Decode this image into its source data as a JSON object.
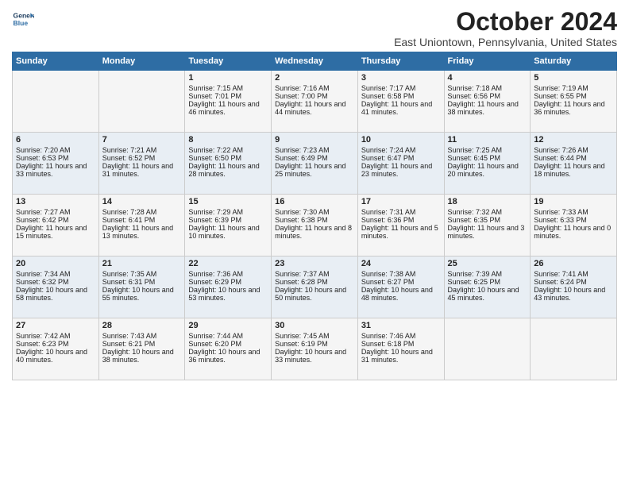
{
  "header": {
    "logo_line1": "General",
    "logo_line2": "Blue",
    "month": "October 2024",
    "location": "East Uniontown, Pennsylvania, United States"
  },
  "weekdays": [
    "Sunday",
    "Monday",
    "Tuesday",
    "Wednesday",
    "Thursday",
    "Friday",
    "Saturday"
  ],
  "weeks": [
    [
      {
        "day": "",
        "content": ""
      },
      {
        "day": "",
        "content": ""
      },
      {
        "day": "1",
        "content": "Sunrise: 7:15 AM\nSunset: 7:01 PM\nDaylight: 11 hours and 46 minutes."
      },
      {
        "day": "2",
        "content": "Sunrise: 7:16 AM\nSunset: 7:00 PM\nDaylight: 11 hours and 44 minutes."
      },
      {
        "day": "3",
        "content": "Sunrise: 7:17 AM\nSunset: 6:58 PM\nDaylight: 11 hours and 41 minutes."
      },
      {
        "day": "4",
        "content": "Sunrise: 7:18 AM\nSunset: 6:56 PM\nDaylight: 11 hours and 38 minutes."
      },
      {
        "day": "5",
        "content": "Sunrise: 7:19 AM\nSunset: 6:55 PM\nDaylight: 11 hours and 36 minutes."
      }
    ],
    [
      {
        "day": "6",
        "content": "Sunrise: 7:20 AM\nSunset: 6:53 PM\nDaylight: 11 hours and 33 minutes."
      },
      {
        "day": "7",
        "content": "Sunrise: 7:21 AM\nSunset: 6:52 PM\nDaylight: 11 hours and 31 minutes."
      },
      {
        "day": "8",
        "content": "Sunrise: 7:22 AM\nSunset: 6:50 PM\nDaylight: 11 hours and 28 minutes."
      },
      {
        "day": "9",
        "content": "Sunrise: 7:23 AM\nSunset: 6:49 PM\nDaylight: 11 hours and 25 minutes."
      },
      {
        "day": "10",
        "content": "Sunrise: 7:24 AM\nSunset: 6:47 PM\nDaylight: 11 hours and 23 minutes."
      },
      {
        "day": "11",
        "content": "Sunrise: 7:25 AM\nSunset: 6:45 PM\nDaylight: 11 hours and 20 minutes."
      },
      {
        "day": "12",
        "content": "Sunrise: 7:26 AM\nSunset: 6:44 PM\nDaylight: 11 hours and 18 minutes."
      }
    ],
    [
      {
        "day": "13",
        "content": "Sunrise: 7:27 AM\nSunset: 6:42 PM\nDaylight: 11 hours and 15 minutes."
      },
      {
        "day": "14",
        "content": "Sunrise: 7:28 AM\nSunset: 6:41 PM\nDaylight: 11 hours and 13 minutes."
      },
      {
        "day": "15",
        "content": "Sunrise: 7:29 AM\nSunset: 6:39 PM\nDaylight: 11 hours and 10 minutes."
      },
      {
        "day": "16",
        "content": "Sunrise: 7:30 AM\nSunset: 6:38 PM\nDaylight: 11 hours and 8 minutes."
      },
      {
        "day": "17",
        "content": "Sunrise: 7:31 AM\nSunset: 6:36 PM\nDaylight: 11 hours and 5 minutes."
      },
      {
        "day": "18",
        "content": "Sunrise: 7:32 AM\nSunset: 6:35 PM\nDaylight: 11 hours and 3 minutes."
      },
      {
        "day": "19",
        "content": "Sunrise: 7:33 AM\nSunset: 6:33 PM\nDaylight: 11 hours and 0 minutes."
      }
    ],
    [
      {
        "day": "20",
        "content": "Sunrise: 7:34 AM\nSunset: 6:32 PM\nDaylight: 10 hours and 58 minutes."
      },
      {
        "day": "21",
        "content": "Sunrise: 7:35 AM\nSunset: 6:31 PM\nDaylight: 10 hours and 55 minutes."
      },
      {
        "day": "22",
        "content": "Sunrise: 7:36 AM\nSunset: 6:29 PM\nDaylight: 10 hours and 53 minutes."
      },
      {
        "day": "23",
        "content": "Sunrise: 7:37 AM\nSunset: 6:28 PM\nDaylight: 10 hours and 50 minutes."
      },
      {
        "day": "24",
        "content": "Sunrise: 7:38 AM\nSunset: 6:27 PM\nDaylight: 10 hours and 48 minutes."
      },
      {
        "day": "25",
        "content": "Sunrise: 7:39 AM\nSunset: 6:25 PM\nDaylight: 10 hours and 45 minutes."
      },
      {
        "day": "26",
        "content": "Sunrise: 7:41 AM\nSunset: 6:24 PM\nDaylight: 10 hours and 43 minutes."
      }
    ],
    [
      {
        "day": "27",
        "content": "Sunrise: 7:42 AM\nSunset: 6:23 PM\nDaylight: 10 hours and 40 minutes."
      },
      {
        "day": "28",
        "content": "Sunrise: 7:43 AM\nSunset: 6:21 PM\nDaylight: 10 hours and 38 minutes."
      },
      {
        "day": "29",
        "content": "Sunrise: 7:44 AM\nSunset: 6:20 PM\nDaylight: 10 hours and 36 minutes."
      },
      {
        "day": "30",
        "content": "Sunrise: 7:45 AM\nSunset: 6:19 PM\nDaylight: 10 hours and 33 minutes."
      },
      {
        "day": "31",
        "content": "Sunrise: 7:46 AM\nSunset: 6:18 PM\nDaylight: 10 hours and 31 minutes."
      },
      {
        "day": "",
        "content": ""
      },
      {
        "day": "",
        "content": ""
      }
    ]
  ]
}
